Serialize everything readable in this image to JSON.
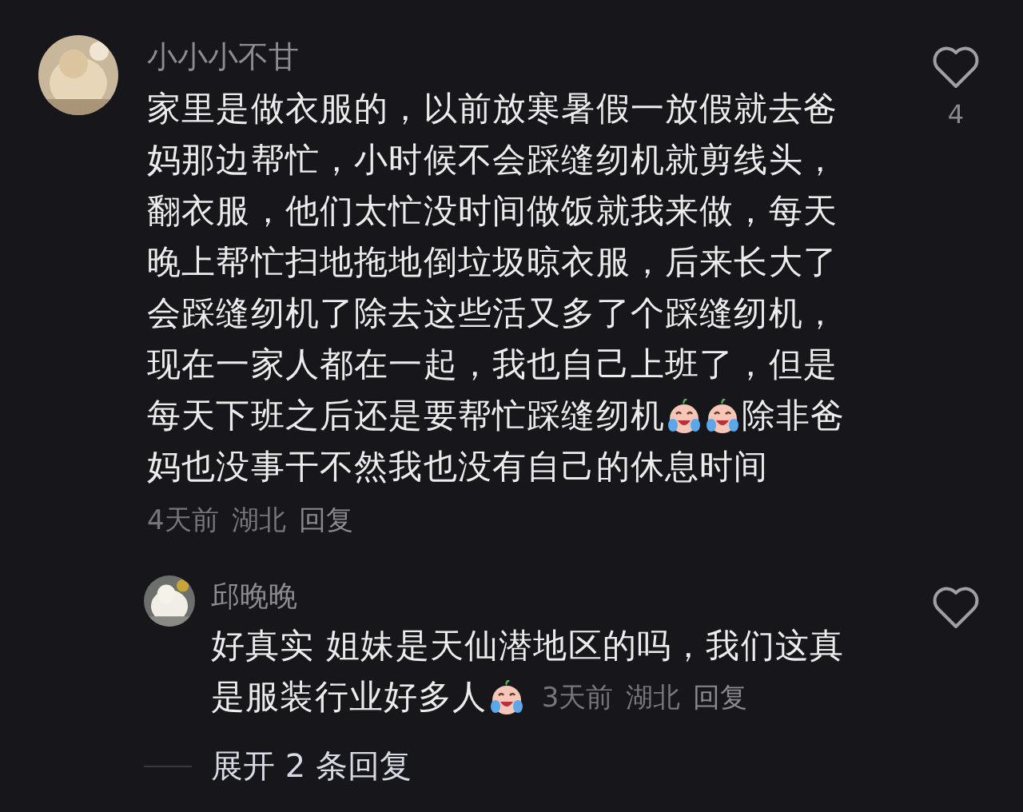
{
  "comments": [
    {
      "kind": "comment",
      "user": "小小小不甘",
      "likes": "4",
      "lines": [
        [
          {
            "kind": "text",
            "text": "家里是做衣服的，以前放寒暑假一放假就去爸"
          }
        ],
        [
          {
            "kind": "text",
            "text": "妈那边帮忙，小时候不会踩缝纫机就剪线头，"
          }
        ],
        [
          {
            "kind": "text",
            "text": "翻衣服，他们太忙没时间做饭就我来做，每天"
          }
        ],
        [
          {
            "kind": "text",
            "text": "晚上帮忙扫地拖地倒垃圾晾衣服，后来长大了"
          }
        ],
        [
          {
            "kind": "text",
            "text": "会踩缝纫机了除去这些活又多了个踩缝纫机，"
          }
        ],
        [
          {
            "kind": "text",
            "text": "现在一家人都在一起，我也自己上班了，但是"
          }
        ],
        [
          {
            "kind": "text",
            "text": "每天下班之后还是要帮忙踩缝纫机"
          },
          {
            "kind": "emoji"
          },
          {
            "kind": "emoji"
          },
          {
            "kind": "text",
            "text": "除非爸"
          }
        ],
        [
          {
            "kind": "text",
            "text": "妈也没事干不然我也没有自己的休息时间"
          }
        ]
      ],
      "meta": [
        "4天前",
        "湖北"
      ],
      "reply_label": "回复"
    },
    {
      "kind": "reply",
      "user": "邱晚晚",
      "lines": [
        [
          {
            "kind": "text",
            "text": "好真实 姐妹是天仙潜地区的吗，我们这真"
          }
        ],
        [
          {
            "kind": "text",
            "text": "是服装行业好多人"
          },
          {
            "kind": "emoji"
          }
        ]
      ],
      "meta": [
        "3天前",
        "湖北"
      ],
      "reply_label": "回复"
    }
  ],
  "expand": "展开 2 条回复"
}
